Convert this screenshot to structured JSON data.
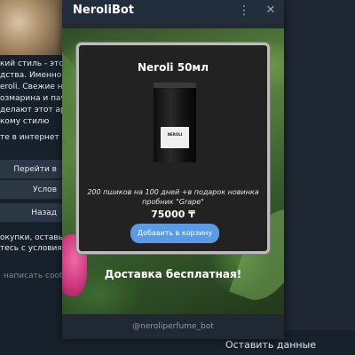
{
  "window": {
    "title": "NeroliBot",
    "footer_handle": "@neroliperfume_bot"
  },
  "card": {
    "product_title": "Neroli 50мл",
    "bottle_label": "NEROLI",
    "description": "200 пшиков на 100 дней +в подарок новинка пробник \"Grape\"",
    "price": "75000 ₸",
    "cart_button_label": "Добавить в корзину"
  },
  "delivery_text": "Доставка бесплатная!",
  "chat": {
    "text_lines": [
      "кий стиль - это си",
      "дства. Именно эти",
      "eroli. Свежие нот",
      "озмарина и пачу",
      "делают этот аром",
      "кому стилю"
    ],
    "text_line2": "те в интернет маг",
    "buttons": [
      "Перейти в",
      "Услов",
      "Назад"
    ],
    "text_lines3": [
      "окупки, оставьте",
      "тесь с условиями"
    ],
    "input_placeholder": "написать сообщение",
    "bottom_button": "Оставить данные"
  },
  "icons": {
    "menu": "vertical-dots-icon",
    "close": "close-icon"
  },
  "colors": {
    "accent_button": "#5a9be6",
    "card_bg": "#222222",
    "card_border": "#bdbdbd"
  }
}
